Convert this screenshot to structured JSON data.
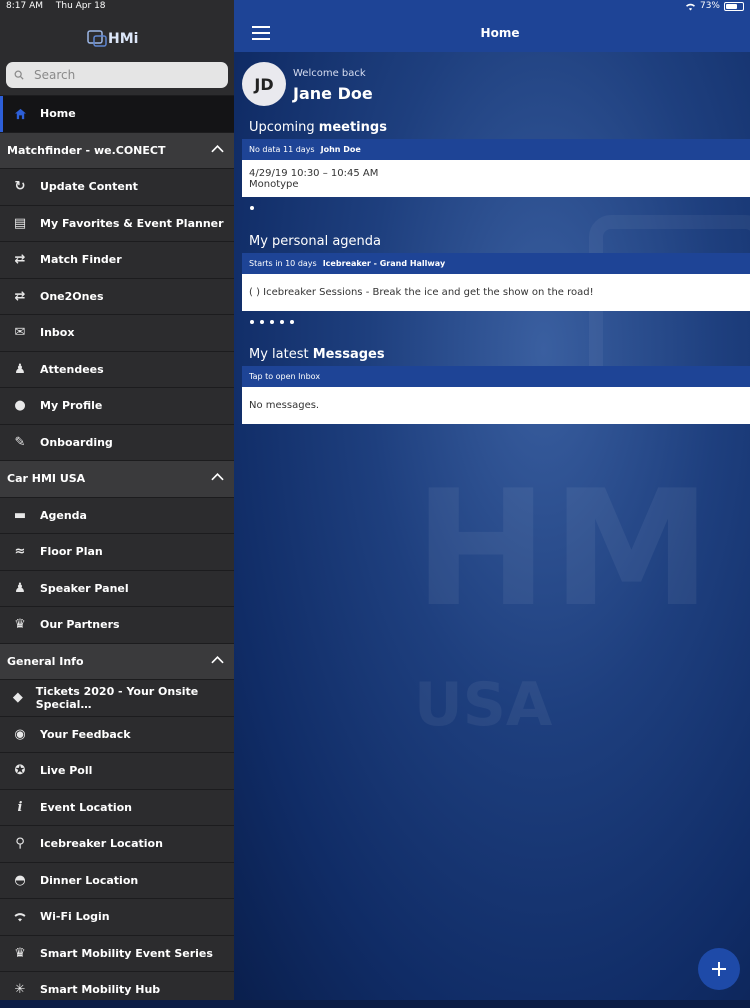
{
  "status_bar": {
    "time": "8:17 AM",
    "date": "Thu Apr 18",
    "battery": "73%",
    "battery_level": 0.73
  },
  "sidebar": {
    "logo_text": "HMi",
    "search_placeholder": "Search",
    "home_label": "Home",
    "sections": [
      {
        "title": "Matchfinder - we.CONECT",
        "items": [
          "Update Content",
          "My Favorites & Event Planner",
          "Match Finder",
          "One2Ones",
          "Inbox",
          "Attendees",
          "My Profile",
          "Onboarding"
        ]
      },
      {
        "title": "Car HMI USA",
        "items": [
          "Agenda",
          "Floor Plan",
          "Speaker Panel",
          "Our Partners"
        ]
      },
      {
        "title": "General Info",
        "items": [
          "Tickets 2020 - Your Onsite Special…",
          "Your Feedback",
          "Live Poll",
          "Event Location",
          "Icebreaker Location",
          "Dinner Location",
          "Wi-Fi Login",
          "Smart Mobility Event Series",
          "Smart Mobility Hub"
        ]
      }
    ]
  },
  "header": {
    "title": "Home"
  },
  "user": {
    "initials": "JD",
    "welcome": "Welcome back",
    "name": "Jane Doe"
  },
  "meetings": {
    "title_light": "Upcoming ",
    "title_bold": "meetings",
    "header_meta": "No data 11 days",
    "header_person": "John Doe",
    "time": "4/29/19 10:30 – 10:45 AM",
    "company": "Monotype"
  },
  "agenda": {
    "title_light": "My personal agenda",
    "header_meta": "Starts in 10 days",
    "header_event": "Icebreaker - Grand Hallway",
    "body": "( ) Icebreaker Sessions - Break the ice and get the show on the road!"
  },
  "messages": {
    "title_light": "My latest ",
    "title_bold": "Messages",
    "header": "Tap to open Inbox",
    "body": "No messages."
  },
  "fab_icon": "plus-icon"
}
